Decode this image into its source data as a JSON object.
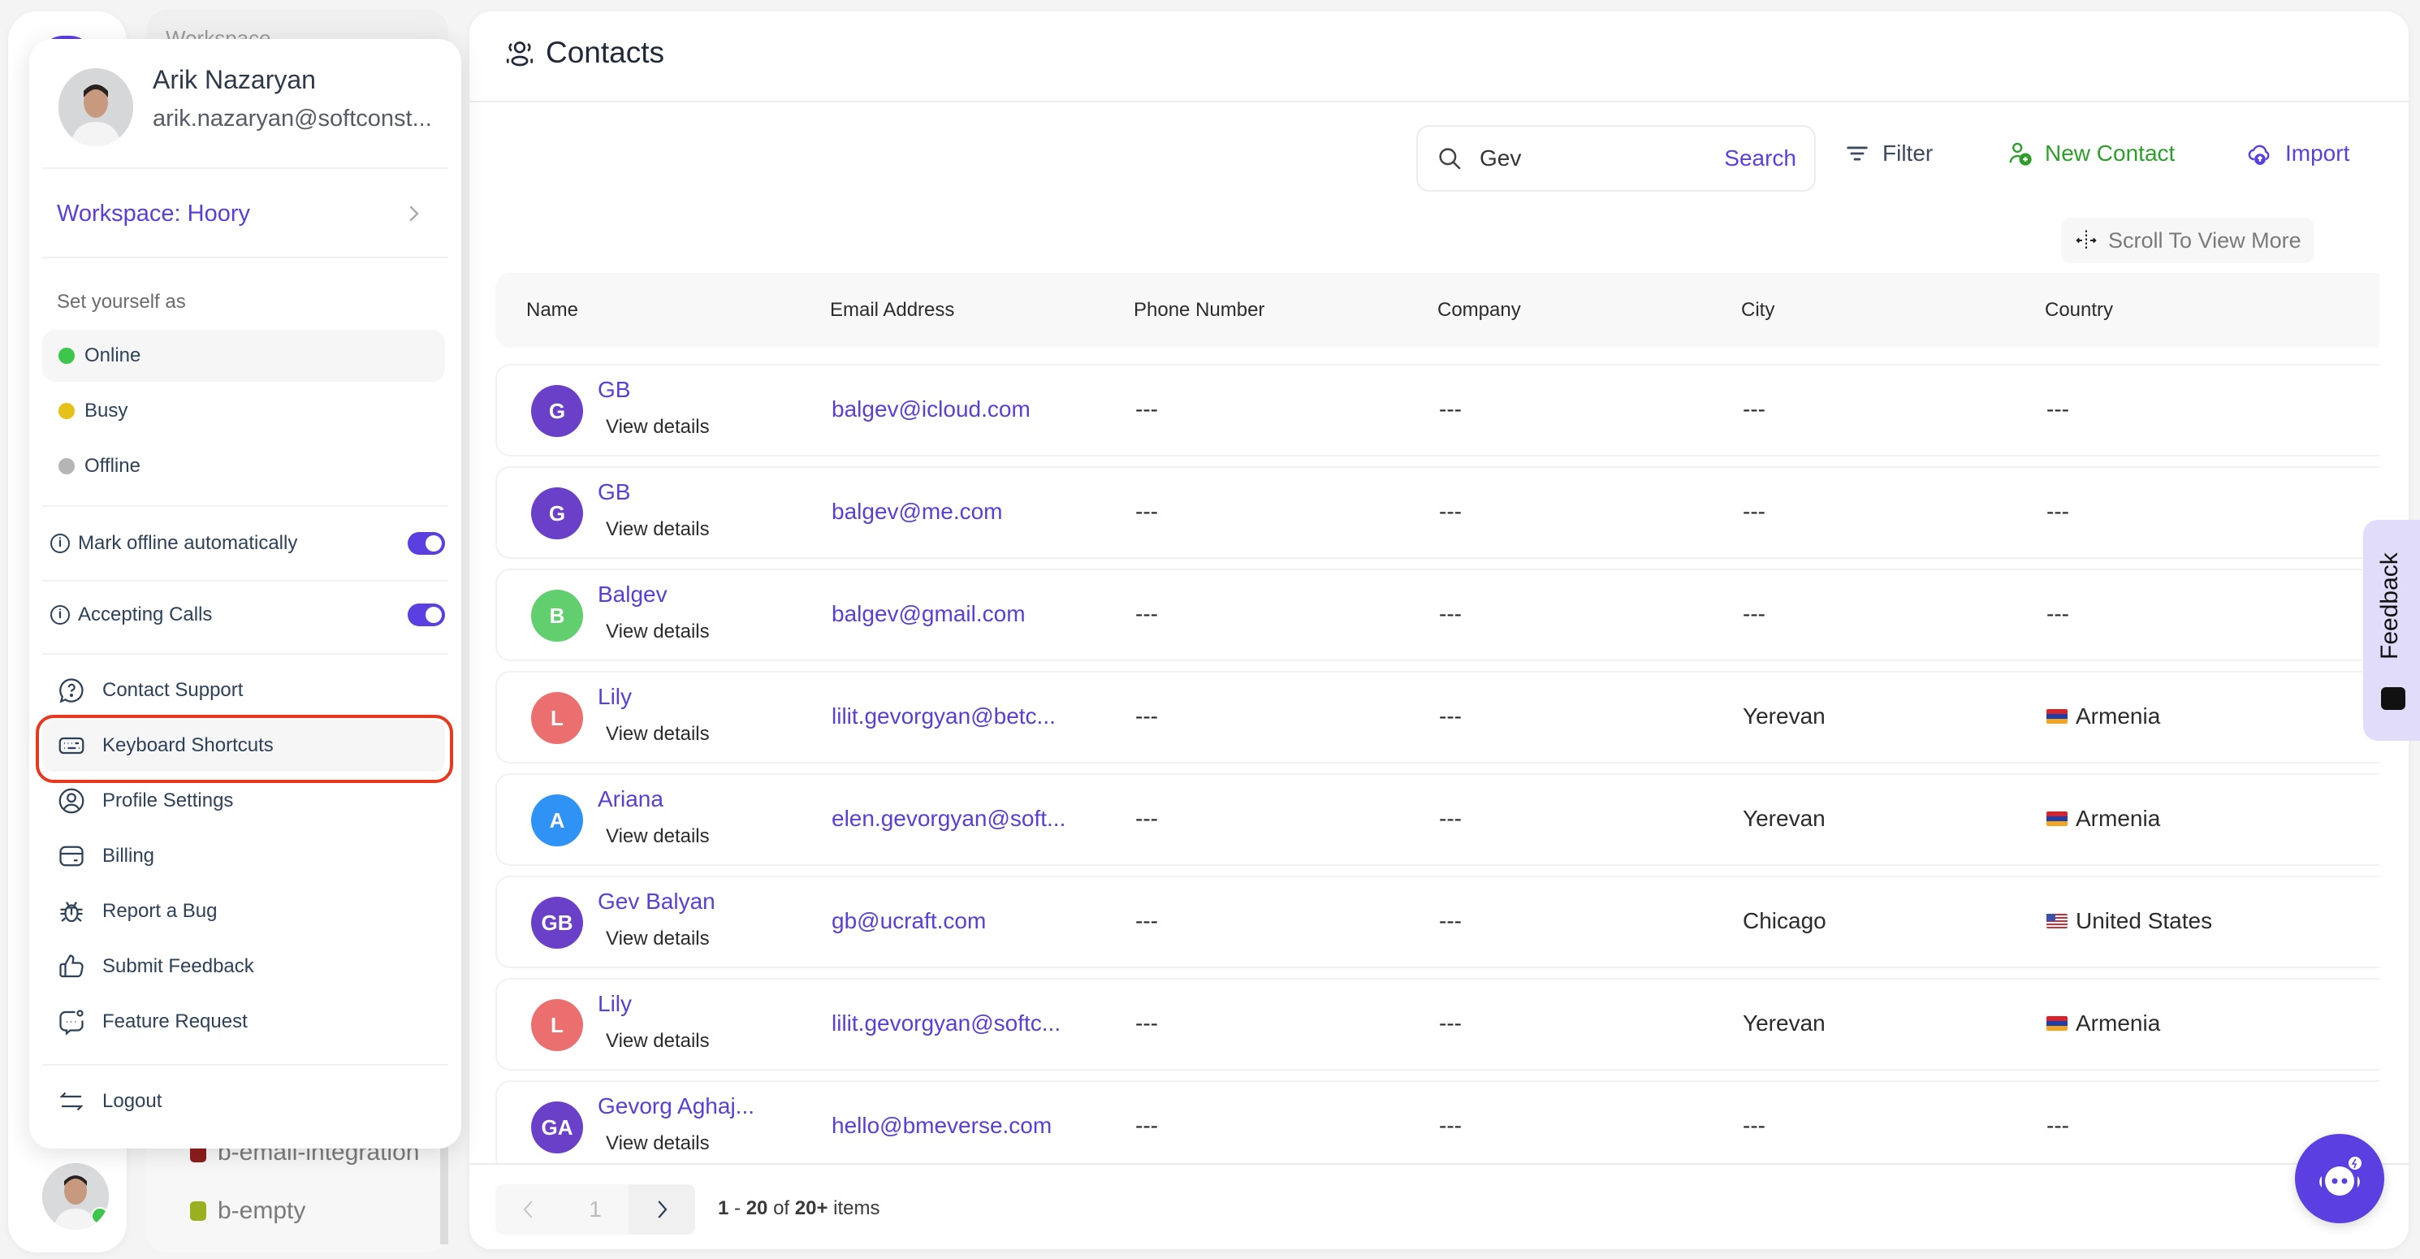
{
  "sidebar": {
    "workspace_heading": "Workspace",
    "labels": [
      {
        "name": "b-email-integration",
        "color": "#8f1c1c"
      },
      {
        "name": "b-empty",
        "color": "#9bb01e"
      }
    ]
  },
  "profile_menu": {
    "name": "Arik Nazaryan",
    "email": "arik.nazaryan@softconst...",
    "workspace_label": "Workspace: Hoory",
    "set_yourself_as": "Set yourself as",
    "statuses": [
      {
        "label": "Online",
        "color": "#3cc74c",
        "active": true
      },
      {
        "label": "Busy",
        "color": "#e6c11a",
        "active": false
      },
      {
        "label": "Offline",
        "color": "#b5b5b5",
        "active": false
      }
    ],
    "toggles": [
      {
        "label": "Mark offline automatically",
        "on": true
      },
      {
        "label": "Accepting Calls",
        "on": true
      }
    ],
    "items": [
      {
        "label": "Contact Support",
        "icon": "help-chat-icon"
      },
      {
        "label": "Keyboard Shortcuts",
        "icon": "keyboard-icon",
        "highlighted": true
      },
      {
        "label": "Profile Settings",
        "icon": "user-circle-icon"
      },
      {
        "label": "Billing",
        "icon": "credit-card-icon"
      },
      {
        "label": "Report a Bug",
        "icon": "bug-icon"
      },
      {
        "label": "Submit Feedback",
        "icon": "thumbs-up-icon"
      },
      {
        "label": "Feature Request",
        "icon": "feature-request-icon"
      }
    ],
    "logout_label": "Logout"
  },
  "main": {
    "title": "Contacts",
    "search": {
      "value": "Gev",
      "placeholder": "Search",
      "button_label": "Search"
    },
    "filter_label": "Filter",
    "new_contact_label": "New Contact",
    "import_label": "Import",
    "scroll_hint": "Scroll To View More",
    "colors": {
      "accent": "#5b3fe0",
      "new_contact": "#2e9e2b",
      "highlight_ring": "#e8391f"
    },
    "table": {
      "columns": [
        "Name",
        "Email Address",
        "Phone Number",
        "Company",
        "City",
        "Country"
      ],
      "view_details_label": "View details",
      "rows": [
        {
          "initials": "G",
          "avatar_color": "#6a40c9",
          "name": "GB",
          "email": "balgev@icloud.com",
          "phone": "---",
          "company": "---",
          "city": "---",
          "country": "---",
          "flag": ""
        },
        {
          "initials": "G",
          "avatar_color": "#6a40c9",
          "name": "GB",
          "email": "balgev@me.com",
          "phone": "---",
          "company": "---",
          "city": "---",
          "country": "---",
          "flag": ""
        },
        {
          "initials": "B",
          "avatar_color": "#62cf6e",
          "name": "Balgev",
          "email": "balgev@gmail.com",
          "phone": "---",
          "company": "---",
          "city": "---",
          "country": "---",
          "flag": ""
        },
        {
          "initials": "L",
          "avatar_color": "#ec6f6f",
          "name": "Lily",
          "email": "lilit.gevorgyan@betc...",
          "phone": "---",
          "company": "---",
          "city": "Yerevan",
          "country": "Armenia",
          "flag": "am"
        },
        {
          "initials": "A",
          "avatar_color": "#2f93f5",
          "name": "Ariana",
          "email": "elen.gevorgyan@soft...",
          "phone": "---",
          "company": "---",
          "city": "Yerevan",
          "country": "Armenia",
          "flag": "am"
        },
        {
          "initials": "GB",
          "avatar_color": "#6a40c9",
          "name": "Gev Balyan",
          "email": "gb@ucraft.com",
          "phone": "---",
          "company": "---",
          "city": "Chicago",
          "country": "United States",
          "flag": "us"
        },
        {
          "initials": "L",
          "avatar_color": "#ec6f6f",
          "name": "Lily",
          "email": "lilit.gevorgyan@softc...",
          "phone": "---",
          "company": "---",
          "city": "Yerevan",
          "country": "Armenia",
          "flag": "am"
        },
        {
          "initials": "GA",
          "avatar_color": "#6a40c9",
          "name": "Gevorg Aghaj...",
          "email": "hello@bmeverse.com",
          "phone": "---",
          "company": "---",
          "city": "---",
          "country": "---",
          "flag": ""
        }
      ]
    },
    "pagination": {
      "current_page": "1",
      "range_start": "1",
      "range_end": "20",
      "total": "20+",
      "of_label": "of",
      "items_label": "items"
    }
  },
  "feedback_tab_label": "Feedback"
}
